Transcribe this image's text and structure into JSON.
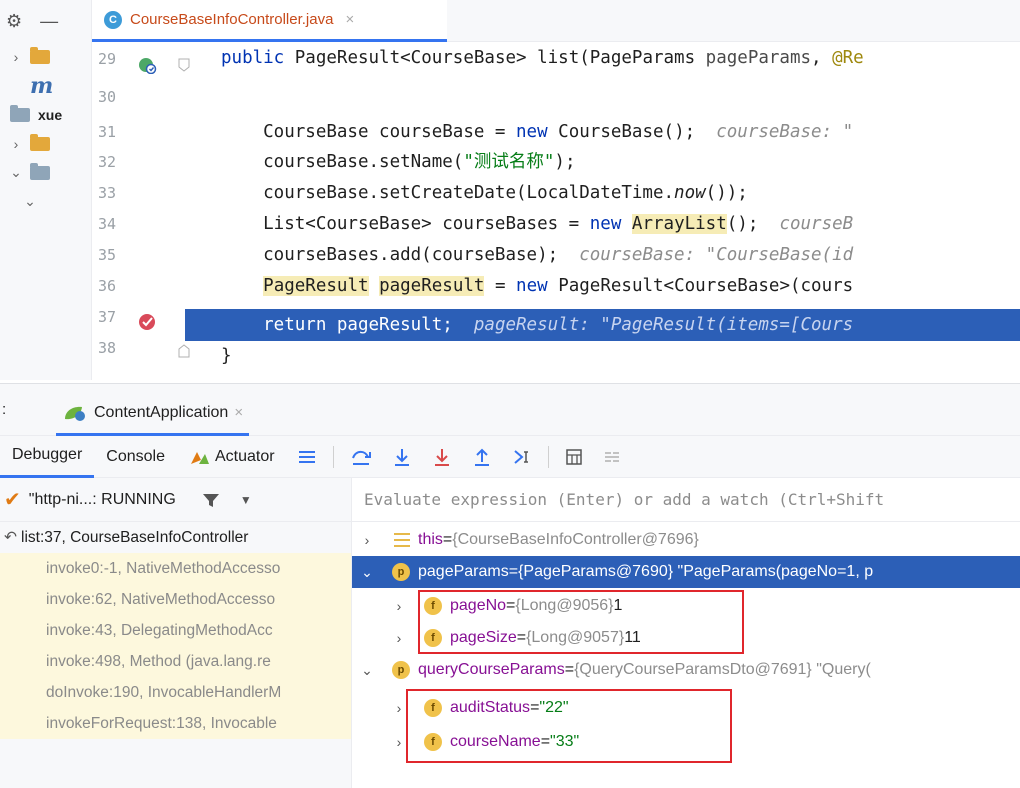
{
  "editor": {
    "file_tab": {
      "icon_letter": "C",
      "name": "CourseBaseInfoController.java",
      "close": "×"
    },
    "project": {
      "toolbar": [
        "⚙",
        "—"
      ],
      "rows": [
        {
          "chev": "›",
          "icon": "folder",
          "label": ""
        },
        {
          "chev": "",
          "icon": "m",
          "label": "m"
        },
        {
          "chev": "",
          "icon": "folder-gray",
          "label": "xue"
        },
        {
          "chev": "›",
          "icon": "folder",
          "label": ""
        },
        {
          "chev": "⌄",
          "icon": "folder-gray",
          "label": ""
        },
        {
          "chev": "⌄",
          "icon": "",
          "label": ""
        }
      ]
    },
    "line_numbers": [
      "29",
      "30",
      "31",
      "32",
      "33",
      "34",
      "35",
      "36",
      "37",
      "38"
    ],
    "code": {
      "l29": {
        "kw": "public ",
        "a": "PageResult<CourseBase> list(PageParams ",
        "b": "pageParams",
        "c": ", ",
        "d": "@Re"
      },
      "l31": {
        "a": "    CourseBase courseBase = ",
        "kw": "new ",
        "b": "CourseBase();  ",
        "hint": "courseBase: \""
      },
      "l32": {
        "a": "    courseBase.setName(",
        "str": "\"测试名称\"",
        "b": ");"
      },
      "l33": {
        "a": "    courseBase.setCreateDate(LocalDateTime.",
        "it": "now",
        "b": "());"
      },
      "l34": {
        "a": "    List<CourseBase> courseBases = ",
        "kw": "new ",
        "hl": "ArrayList",
        "b": "();  ",
        "hint": "courseB"
      },
      "l35": {
        "a": "    courseBases.add(courseBase);  ",
        "hint": "courseBase: \"CourseBase(id"
      },
      "l36": {
        "hl1": "PageResult",
        "a": " ",
        "hl2": "pageResult",
        "b": " = ",
        "kw": "new ",
        "c": "PageResult<CourseBase>(cours"
      },
      "l37": {
        "a": "    return pageResult;  ",
        "hint": "pageResult: \"PageResult(items=[Cours"
      },
      "l38": {
        "a": "}"
      }
    }
  },
  "debug": {
    "left_label": ":",
    "run_tab": {
      "name": "ContentApplication",
      "close": "×"
    },
    "tabs": {
      "debugger": "Debugger",
      "console": "Console",
      "actuator": "Actuator"
    },
    "thread": {
      "name": "\"http-ni...: RUNNING"
    },
    "frames": [
      {
        "text": "list:37, CourseBaseInfoController",
        "current": true
      },
      {
        "text": "invoke0:-1, NativeMethodAccesso",
        "current": false
      },
      {
        "text": "invoke:62, NativeMethodAccesso",
        "current": false
      },
      {
        "text": "invoke:43, DelegatingMethodAcc",
        "current": false
      },
      {
        "text": "invoke:498, Method (java.lang.re",
        "current": false
      },
      {
        "text": "doInvoke:190, InvocableHandlerM",
        "current": false
      },
      {
        "text": "invokeForRequest:138, Invocable",
        "current": false
      }
    ],
    "eval_placeholder": "Evaluate expression (Enter) or add a watch (Ctrl+Shift",
    "vars": {
      "this": {
        "name": "this",
        "eq": " = ",
        "val": "{CourseBaseInfoController@7696}"
      },
      "pageParams": {
        "badge": "p",
        "name": "pageParams",
        "eq": " = ",
        "val": "{PageParams@7690} \"PageParams(pageNo=1, p"
      },
      "pageNo": {
        "badge": "f",
        "name": "pageNo",
        "eq": " = ",
        "val": "{Long@9056} ",
        "num": "1"
      },
      "pageSize": {
        "badge": "f",
        "name": "pageSize",
        "eq": " = ",
        "val": "{Long@9057} ",
        "num": "11"
      },
      "queryCourseParams": {
        "badge": "p",
        "name": "queryCourseParams",
        "eq": " = ",
        "val": "{QueryCourseParamsDto@7691} \"Query("
      },
      "auditStatus": {
        "badge": "f",
        "name": "auditStatus",
        "eq": " = ",
        "str": "\"22\""
      },
      "courseName": {
        "badge": "f",
        "name": "courseName",
        "eq": " = ",
        "str": "\"33\""
      }
    }
  },
  "colors": {
    "accent": "#3574f0",
    "selection": "#2c5fb7",
    "annotation_box": "#e0262c",
    "keyword": "#0033b3",
    "string": "#067d17"
  }
}
